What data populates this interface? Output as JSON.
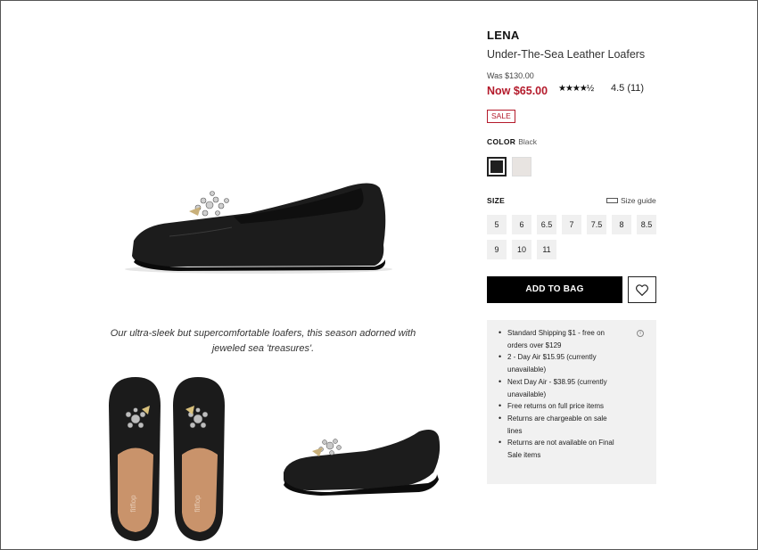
{
  "product": {
    "brand": "LENA",
    "name": "Under-The-Sea Leather Loafers",
    "was_price": "Was $130.00",
    "now_price": "Now $65.00",
    "rating_stars": "★★★★½",
    "rating_text": "4.5 (11)",
    "sale_badge": "SALE",
    "description": "Our ultra-sleek but supercomfortable loafers, this season adorned with jeweled sea 'treasures'."
  },
  "color": {
    "label": "COLOR",
    "value": "Black",
    "swatches": [
      {
        "name": "Black",
        "hex": "#1f1f1f"
      },
      {
        "name": "Grey",
        "hex": "#e8e4e1"
      }
    ]
  },
  "size": {
    "label": "SIZE",
    "guide": "Size guide",
    "options": [
      "5",
      "6",
      "6.5",
      "7",
      "7.5",
      "8",
      "8.5",
      "9",
      "10",
      "11"
    ]
  },
  "actions": {
    "add_to_bag": "ADD TO BAG",
    "wishlist_icon": "heart-icon"
  },
  "shipping": {
    "items": [
      "Standard Shipping $1 - free on orders over $129",
      "2 - Day Air $15.95 (currently unavailable)",
      "Next Day Air - $38.95 (currently unavailable)",
      "Free returns on full price items",
      "Returns are chargeable on sale lines",
      "Returns are not available on Final Sale items"
    ]
  },
  "colors": {
    "sale_red": "#b41a2b",
    "button_black": "#000000",
    "shipping_bg": "#f1f1f1"
  }
}
